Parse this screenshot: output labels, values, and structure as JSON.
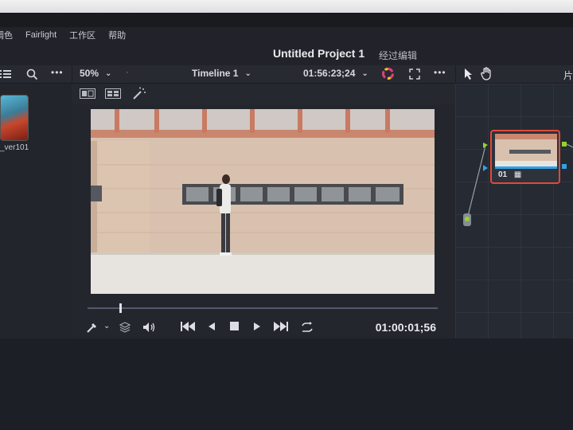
{
  "menu": {
    "items": [
      "调色",
      "Fairlight",
      "工作区",
      "帮助"
    ]
  },
  "title": {
    "project": "Untitled Project 1",
    "subtitle": "经过编辑"
  },
  "toolbar": {
    "zoom": "50%",
    "timeline": "Timeline 1",
    "timecode": "01:56:23;24",
    "right_label": "片"
  },
  "clip": {
    "label": "_ver101"
  },
  "viewer": {
    "playhead_position": 0.1,
    "timecode": "01:00:01;56"
  },
  "node": {
    "label": "01"
  },
  "icons": {
    "list": "list-icon",
    "search": "search-icon",
    "more": "more-icon",
    "color_wheel": "color-wheel-icon",
    "fullscreen": "fullscreen-icon",
    "pointer": "pointer-icon",
    "hand": "hand-icon"
  },
  "colors": {
    "accent_red": "#e04a3a",
    "node_green": "#8ed62c",
    "node_blue": "#2fa3e8"
  }
}
